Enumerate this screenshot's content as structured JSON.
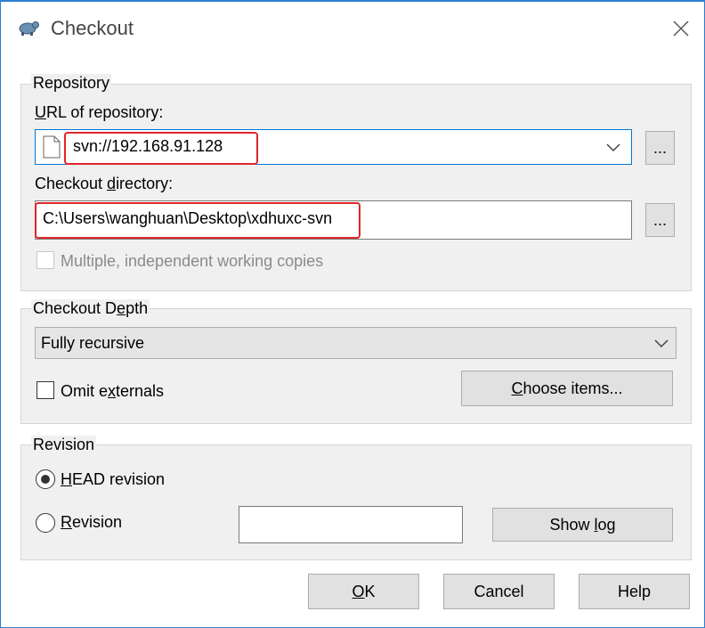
{
  "window": {
    "title": "Checkout",
    "close_glyph": "✕"
  },
  "repository": {
    "group_label": "Repository",
    "url_label_accel": "U",
    "url_label_rest": "RL of repository:",
    "url_value": "svn://192.168.91.128",
    "url_browse": "...",
    "dir_label_pre": "Checkout ",
    "dir_label_accel": "d",
    "dir_label_post": "irectory:",
    "dir_value": "C:\\Users\\wanghuan\\Desktop\\xdhuxc-svn",
    "dir_browse": "...",
    "multiple_label": "Multiple, independent working copies"
  },
  "depth": {
    "group_label_pre": "Checkout D",
    "group_label_accel": "e",
    "group_label_post": "pth",
    "selected": "Fully recursive",
    "omit_pre": "Omit e",
    "omit_accel": "x",
    "omit_post": "ternals",
    "choose_accel": "C",
    "choose_rest": "hoose items..."
  },
  "revision": {
    "group_label": "Revision",
    "head_accel": "H",
    "head_rest": "EAD revision",
    "rev_accel": "R",
    "rev_rest": "evision",
    "rev_value": "",
    "showlog_pre": "Show ",
    "showlog_accel": "l",
    "showlog_post": "og"
  },
  "buttons": {
    "ok_accel": "O",
    "ok_rest": "K",
    "cancel": "Cancel",
    "help": "Help"
  },
  "colors": {
    "accent": "#0078d7",
    "highlight": "#e0262b",
    "group_bg": "#f0f0f0"
  },
  "icons": [
    "tortoise-svn-icon",
    "file-icon",
    "chevron-down-icon",
    "close-icon"
  ]
}
